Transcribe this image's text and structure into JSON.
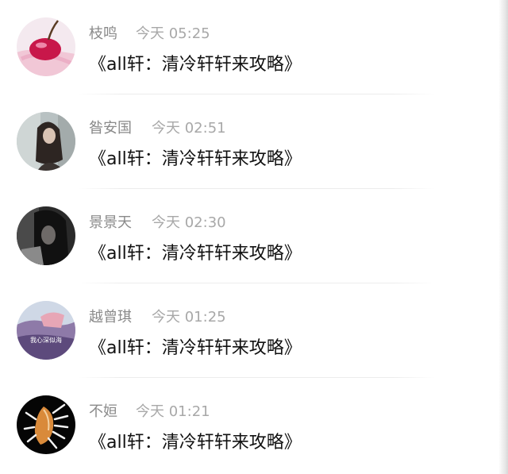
{
  "messages": [
    {
      "name": "枝鸣",
      "time": "今天 05:25",
      "title": "《all轩：清冷轩轩来攻略》",
      "avatar_icon": "cherry-icon"
    },
    {
      "name": "昝安国",
      "time": "今天 02:51",
      "title": "《all轩：清冷轩轩来攻略》",
      "avatar_icon": "girl-photo-icon"
    },
    {
      "name": "景景天",
      "time": "今天 02:30",
      "title": "《all轩：清冷轩轩来攻略》",
      "avatar_icon": "dark-portrait-icon"
    },
    {
      "name": "越曾琪",
      "time": "今天 01:25",
      "title": "《all轩：清冷轩轩来攻略》",
      "avatar_icon": "sea-poster-icon",
      "avatar_text": "我心深似海"
    },
    {
      "name": "不姮",
      "time": "今天 01:21",
      "title": "《all轩：清冷轩轩来攻略》",
      "avatar_icon": "shell-icon"
    }
  ],
  "colors": {
    "name": "#8a8a8a",
    "time": "#a8a8a8",
    "title": "#111111"
  }
}
